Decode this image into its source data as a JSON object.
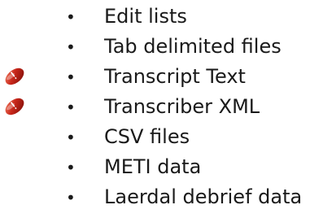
{
  "list": {
    "items": [
      {
        "label": "Edit lists",
        "flagged": false
      },
      {
        "label": "Tab delimited files",
        "flagged": false
      },
      {
        "label": "Transcript Text",
        "flagged": true
      },
      {
        "label": "Transcriber XML",
        "flagged": true
      },
      {
        "label": "CSV files",
        "flagged": false
      },
      {
        "label": "METI data",
        "flagged": false
      },
      {
        "label": "Laerdal debrief data",
        "flagged": false
      }
    ],
    "bullet_glyph": "•",
    "marker_icon": "red-capsule-marker-icon",
    "colors": {
      "text": "#1a1a1a",
      "marker_dark": "#a8180f",
      "marker_light": "#e8503a"
    }
  }
}
